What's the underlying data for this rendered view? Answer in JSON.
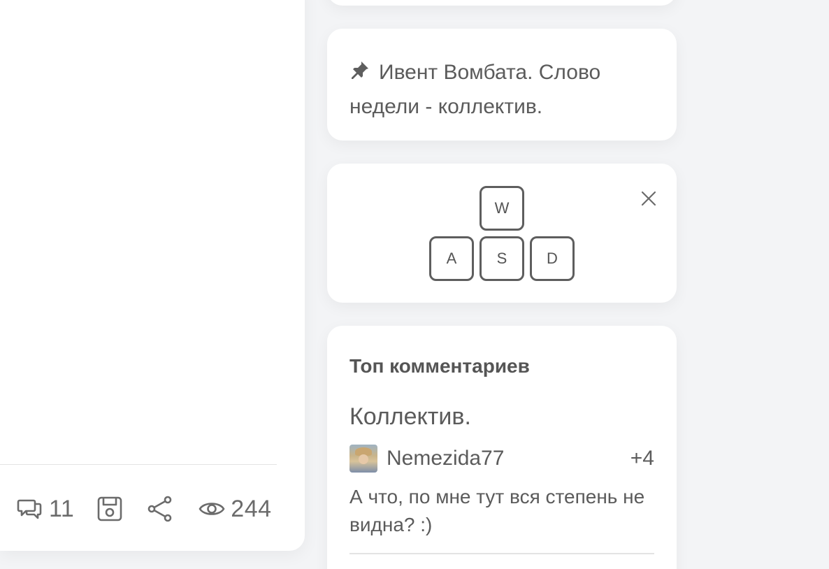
{
  "post": {
    "comments_count": "11",
    "views_count": "244"
  },
  "pinned": {
    "text": "Ивент Вомбата. Слово недели - коллектив."
  },
  "keys": {
    "w": "W",
    "a": "A",
    "s": "S",
    "d": "D"
  },
  "top_comments": {
    "title": "Топ комментариев",
    "post_title": "Коллектив.",
    "author": "Nemezida77",
    "score": "+4",
    "comment": "А что, по мне тут вся степень не видна? :)"
  },
  "icons": [
    "comments-icon",
    "save-icon",
    "share-icon",
    "eye-icon",
    "pin-icon",
    "close-icon"
  ]
}
